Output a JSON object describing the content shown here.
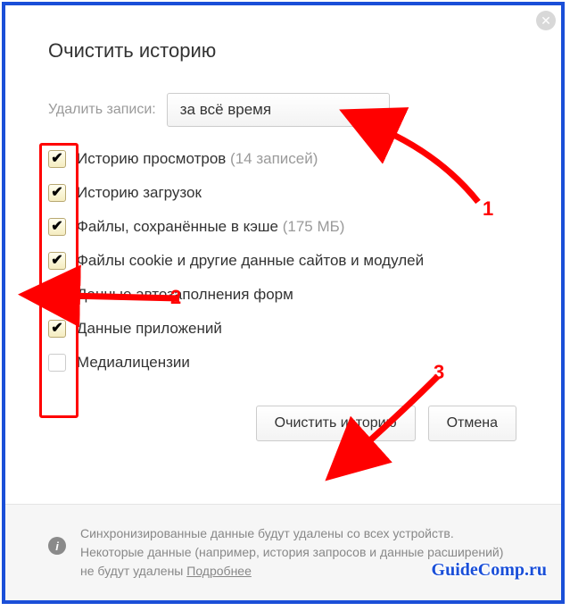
{
  "dialog": {
    "title": "Очистить историю",
    "close_icon": "✕",
    "time_label": "Удалить записи:",
    "time_select": {
      "value": "за всё время"
    },
    "items": [
      {
        "label": "Историю просмотров",
        "hint": "(14 записей)",
        "checked": true
      },
      {
        "label": "Историю загрузок",
        "hint": "",
        "checked": true
      },
      {
        "label": "Файлы, сохранённые в кэше",
        "hint": "(175 МБ)",
        "checked": true
      },
      {
        "label": "Файлы cookie и другие данные сайтов и модулей",
        "hint": "",
        "checked": true
      },
      {
        "label": "Данные автозаполнения форм",
        "hint": "",
        "checked": false
      },
      {
        "label": "Данные приложений",
        "hint": "",
        "checked": true
      },
      {
        "label": "Медиалицензии",
        "hint": "",
        "checked": false
      }
    ],
    "buttons": {
      "clear": "Очистить историю",
      "cancel": "Отмена"
    },
    "footer": {
      "text": "Синхронизированные данные будут удалены со всех устройств. Некоторые данные (например, история запросов и данные расширений) не будут удалены ",
      "link": "Подробнее"
    }
  },
  "annotations": {
    "n1": "1",
    "n2": "2",
    "n3": "3"
  },
  "watermark": "GuideComp.ru"
}
